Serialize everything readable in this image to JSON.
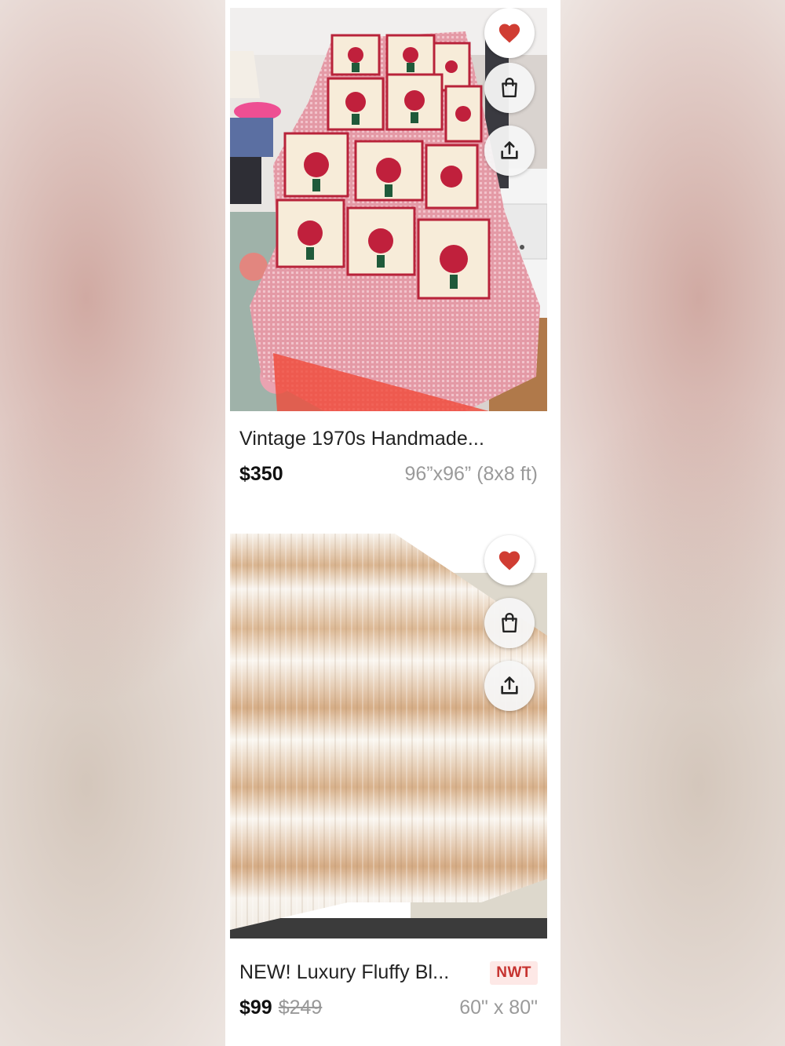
{
  "listings": [
    {
      "title": "Vintage 1970s Handmade...",
      "price": "$350",
      "size": "96”x96” (8x8 ft)",
      "liked": true,
      "image": "red-white-quilt-photo"
    },
    {
      "title": "NEW! Luxury Fluffy Bl...",
      "badge": "NWT",
      "price": "$99",
      "original_price": "$249",
      "size": "60\" x 80\"",
      "liked": true,
      "image": "faux-fur-blanket-photo"
    }
  ],
  "icons": {
    "like": "heart-icon",
    "bag": "shopping-bag-icon",
    "share": "share-icon"
  },
  "colors": {
    "heart": "#d03d33",
    "badge_bg": "#fde8e6",
    "badge_text": "#c6322f",
    "price": "#111111",
    "muted": "#9a9a9a"
  }
}
